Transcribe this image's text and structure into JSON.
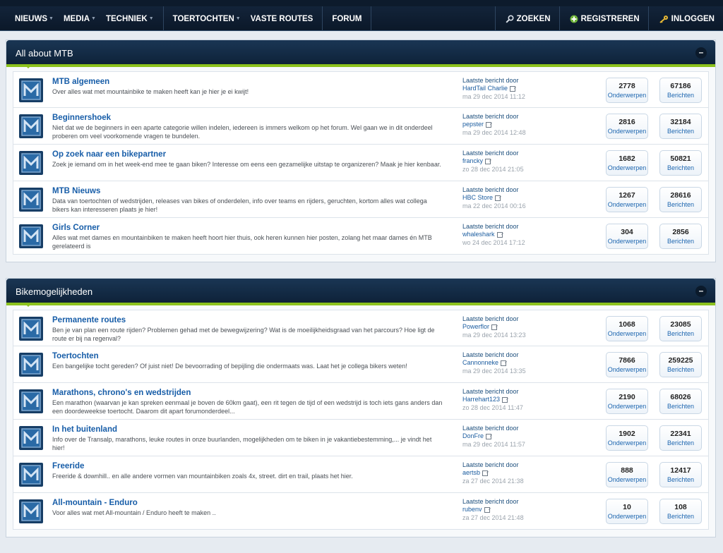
{
  "nav": {
    "left": [
      {
        "label": "NIEUWS",
        "arrow": true
      },
      {
        "label": "MEDIA",
        "arrow": true
      },
      {
        "label": "TECHNIEK",
        "arrow": true
      },
      {
        "label": "TOERTOCHTEN",
        "arrow": true
      },
      {
        "label": "VASTE ROUTES",
        "arrow": false
      },
      {
        "label": "FORUM",
        "arrow": false
      }
    ],
    "search_label": "ZOEKEN",
    "register_label": "REGISTREREN",
    "login_label": "INLOGGEN"
  },
  "categories": [
    {
      "title": "All about MTB",
      "collapse": "–",
      "forums": [
        {
          "title": "MTB algemeen",
          "desc": "Over alles wat met mountainbike te maken heeft kan je hier je ei kwijt!",
          "last_label": "Laatste bericht door",
          "last_user": "HardTail Charlie",
          "last_date": "ma 29 dec 2014 11:12",
          "topics": "2778",
          "topics_label": "Onderwerpen",
          "posts": "67186",
          "posts_label": "Berichten"
        },
        {
          "title": "Beginnershoek",
          "desc": "Niet dat we de beginners in een aparte categorie willen indelen, iedereen is immers welkom op het forum. Wel gaan we in dit onderdeel proberen om veel voorkomende vragen te bundelen.",
          "last_label": "Laatste bericht door",
          "last_user": "pepster",
          "last_date": "ma 29 dec 2014 12:48",
          "topics": "2816",
          "topics_label": "Onderwerpen",
          "posts": "32184",
          "posts_label": "Berichten"
        },
        {
          "title": "Op zoek naar een bikepartner",
          "desc": "Zoek je iemand om in het week-end mee te gaan biken? Interesse om eens een gezamelijke uitstap te organizeren? Maak je hier kenbaar.",
          "last_label": "Laatste bericht door",
          "last_user": "francky",
          "last_date": "zo 28 dec 2014 21:05",
          "topics": "1682",
          "topics_label": "Onderwerpen",
          "posts": "50821",
          "posts_label": "Berichten"
        },
        {
          "title": "MTB Nieuws",
          "desc": "Data van toertochten of wedstrijden, releases van bikes of onderdelen, info over teams en rijders, geruchten, kortom alles wat collega bikers kan interesseren plaats je hier!",
          "last_label": "Laatste bericht door",
          "last_user": "HBC Store",
          "last_date": "ma 22 dec 2014 00:16",
          "topics": "1267",
          "topics_label": "Onderwerpen",
          "posts": "28616",
          "posts_label": "Berichten"
        },
        {
          "title": "Girls Corner",
          "desc": "Alles wat met dames en mountainbiken te maken heeft hoort hier thuis, ook heren kunnen hier posten, zolang het maar dames én MTB gerelateerd is",
          "last_label": "Laatste bericht door",
          "last_user": "whaleshark",
          "last_date": "wo 24 dec 2014 17:12",
          "topics": "304",
          "topics_label": "Onderwerpen",
          "posts": "2856",
          "posts_label": "Berichten"
        }
      ]
    },
    {
      "title": "Bikemogelijkheden",
      "collapse": "–",
      "forums": [
        {
          "title": "Permanente routes",
          "desc": "Ben je van plan een route rijden? Problemen gehad met de bewegwijzering? Wat is de moeilijkheidsgraad van het parcours? Hoe ligt de route er bij na regenval?",
          "last_label": "Laatste bericht door",
          "last_user": "Powerflor",
          "last_date": "ma 29 dec 2014 13:23",
          "topics": "1068",
          "topics_label": "Onderwerpen",
          "posts": "23085",
          "posts_label": "Berichten"
        },
        {
          "title": "Toertochten",
          "desc": "Een bangelijke tocht gereden? Of juist niet! De bevoorrading of bepijling die ondermaats was. Laat het je collega bikers weten!",
          "last_label": "Laatste bericht door",
          "last_user": "Cannonneke",
          "last_date": "ma 29 dec 2014 13:35",
          "topics": "7866",
          "topics_label": "Onderwerpen",
          "posts": "259225",
          "posts_label": "Berichten"
        },
        {
          "title": "Marathons, chrono's en wedstrijden",
          "desc": "Een marathon (waarvan je kan spreken eenmaal je boven de 60km gaat), een rit tegen de tijd of een wedstrijd is toch iets gans anders dan een doordeweekse toertocht. Daarom dit apart forumonderdeel...",
          "last_label": "Laatste bericht door",
          "last_user": "Harrehart123",
          "last_date": "zo 28 dec 2014 11:47",
          "topics": "2190",
          "topics_label": "Onderwerpen",
          "posts": "68026",
          "posts_label": "Berichten"
        },
        {
          "title": "In het buitenland",
          "desc": "Info over de Transalp, marathons, leuke routes in onze buurlanden, mogelijkheden om te biken in je vakantiebestemming,... je vindt het hier!",
          "last_label": "Laatste bericht door",
          "last_user": "DonFre",
          "last_date": "ma 29 dec 2014 11:57",
          "topics": "1902",
          "topics_label": "Onderwerpen",
          "posts": "22341",
          "posts_label": "Berichten"
        },
        {
          "title": "Freeride",
          "desc": "Freeride & downhill.. en alle andere vormen van mountainbiken zoals 4x, street. dirt en trail, plaats het hier.",
          "last_label": "Laatste bericht door",
          "last_user": "aertsb",
          "last_date": "za 27 dec 2014 21:38",
          "topics": "888",
          "topics_label": "Onderwerpen",
          "posts": "12417",
          "posts_label": "Berichten"
        },
        {
          "title": "All-mountain - Enduro",
          "desc": "Voor alles wat met All-mountain / Enduro heeft te maken ..",
          "last_label": "Laatste bericht door",
          "last_user": "rubenv",
          "last_date": "za 27 dec 2014 21:48",
          "topics": "10",
          "topics_label": "Onderwerpen",
          "posts": "108",
          "posts_label": "Berichten"
        }
      ]
    }
  ]
}
